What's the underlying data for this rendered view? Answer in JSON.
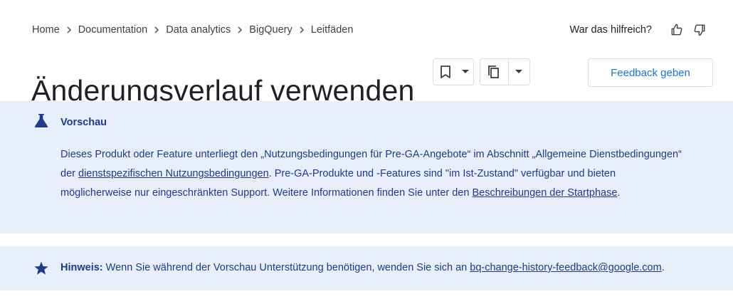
{
  "breadcrumb": [
    "Home",
    "Documentation",
    "Data analytics",
    "BigQuery",
    "Leitfäden"
  ],
  "helpful": {
    "question": "War das hilfreich?",
    "up_icon": "thumb-up-icon",
    "down_icon": "thumb-down-icon"
  },
  "page": {
    "title": "Änderungsverlauf verwenden"
  },
  "buttons": {
    "feedback": "Feedback geben",
    "bookmark_icon": "bookmark-icon",
    "copy_icon": "copy-icon",
    "dropdown_icon": "arrow-drop-down-icon"
  },
  "preview": {
    "icon": "flask-icon",
    "heading": "Vorschau",
    "t1": "Dieses Produkt oder Feature unterliegt den „Nutzungsbedingungen für Pre-GA-Angebote“ im Abschnitt „Allgemeine Dienstbedingungen“ der ",
    "link1": "dienstspezifischen Nutzungsbedingungen",
    "t2": ". Pre-GA-Produkte und -Features sind \"im Ist-Zustand\" verfügbar und bieten möglicherweise nur eingeschränkten Support. Weitere Informationen finden Sie unter den ",
    "link2": "Beschreibungen der Startphase",
    "t3": "."
  },
  "note": {
    "icon": "star-icon",
    "label": "Hinweis:",
    "text": " Wenn Sie während der Vorschau Unterstützung benötigen, wenden Sie sich an ",
    "email": "bq-change-history-feedback@google.com",
    "end": "."
  },
  "colors": {
    "accent": "#1a73e8",
    "callout_bg": "#e8effa",
    "callout_text": "#1e3a8a"
  }
}
